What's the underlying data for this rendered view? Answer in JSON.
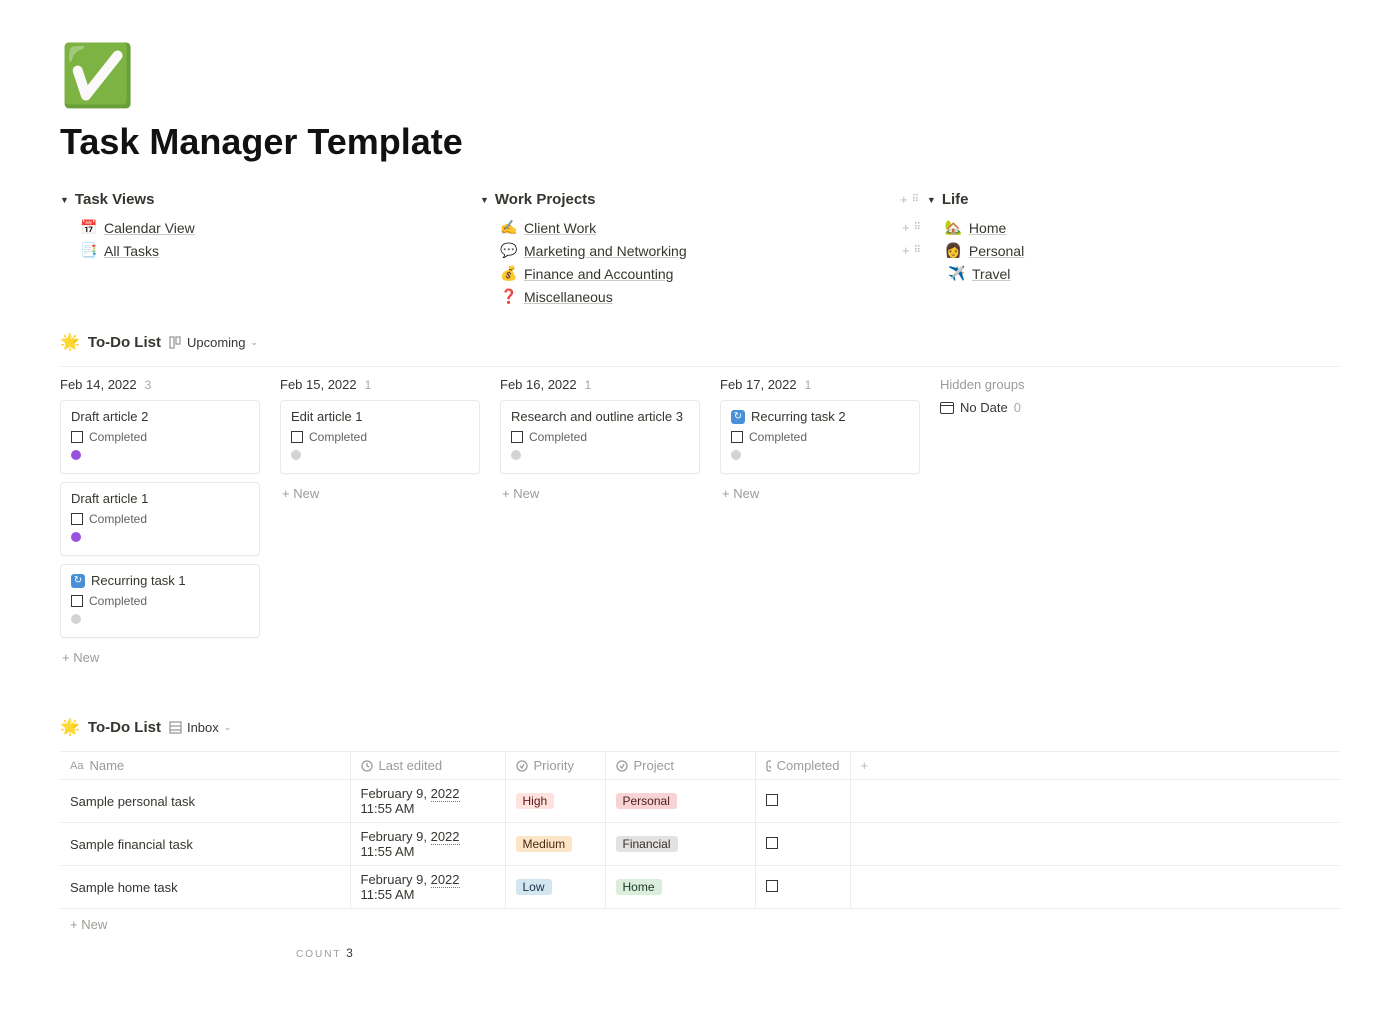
{
  "page": {
    "icon": "✅",
    "title": "Task Manager Template"
  },
  "nav": {
    "col1": {
      "heading": "Task Views",
      "items": [
        {
          "icon": "📅",
          "label": "Calendar View"
        },
        {
          "icon": "📑",
          "label": "All Tasks"
        }
      ]
    },
    "col2": {
      "heading": "Work Projects",
      "items": [
        {
          "icon": "✍️",
          "label": "Client Work"
        },
        {
          "icon": "💬",
          "label": "Marketing and Networking"
        },
        {
          "icon": "💰",
          "label": "Finance and Accounting"
        },
        {
          "icon": "❓",
          "label": "Miscellaneous"
        }
      ]
    },
    "col3": {
      "heading": "Life",
      "items": [
        {
          "icon": "🏡",
          "label": "Home"
        },
        {
          "icon": "👩",
          "label": "Personal"
        },
        {
          "icon": "✈️",
          "label": "Travel"
        }
      ]
    }
  },
  "todo_board": {
    "icon": "🌟",
    "title": "To-Do List",
    "view_label": "Upcoming",
    "completed_label": "Completed",
    "new_label": "+  New",
    "columns": [
      {
        "date": "Feb 14, 2022",
        "count": "3",
        "cards": [
          {
            "title": "Draft article 2",
            "dot": "purple"
          },
          {
            "title": "Draft article 1",
            "dot": "purple"
          },
          {
            "title": "Recurring task 1",
            "dot": "gray",
            "repeat": true
          }
        ]
      },
      {
        "date": "Feb 15, 2022",
        "count": "1",
        "cards": [
          {
            "title": "Edit article 1",
            "dot": "gray"
          }
        ]
      },
      {
        "date": "Feb 16, 2022",
        "count": "1",
        "cards": [
          {
            "title": "Research and outline article 3",
            "dot": "gray"
          }
        ]
      },
      {
        "date": "Feb 17, 2022",
        "count": "1",
        "cards": [
          {
            "title": "Recurring task 2",
            "dot": "gray",
            "repeat": true
          }
        ]
      }
    ],
    "hidden": {
      "title": "Hidden groups",
      "no_date_label": "No Date",
      "no_date_count": "0"
    }
  },
  "todo_table": {
    "icon": "🌟",
    "title": "To-Do List",
    "view_label": "Inbox",
    "new_label": "+  New",
    "count_label": "COUNT",
    "count_value": "3",
    "headers": {
      "name": "Name",
      "last_edited": "Last edited",
      "priority": "Priority",
      "project": "Project",
      "completed": "Completed"
    },
    "rows": [
      {
        "name": "Sample personal task",
        "last_pre": "February 9, ",
        "last_year": "2022",
        "last_post": " 11:55 AM",
        "priority": "High",
        "priority_class": "tag-high",
        "project": "Personal",
        "project_class": "tag-personal"
      },
      {
        "name": "Sample financial task",
        "last_pre": "February 9, ",
        "last_year": "2022",
        "last_post": " 11:55 AM",
        "priority": "Medium",
        "priority_class": "tag-medium",
        "project": "Financial",
        "project_class": "tag-financial"
      },
      {
        "name": "Sample home task",
        "last_pre": "February 9, ",
        "last_year": "2022",
        "last_post": " 11:55 AM",
        "priority": "Low",
        "priority_class": "tag-low",
        "project": "Home",
        "project_class": "tag-home"
      }
    ]
  }
}
